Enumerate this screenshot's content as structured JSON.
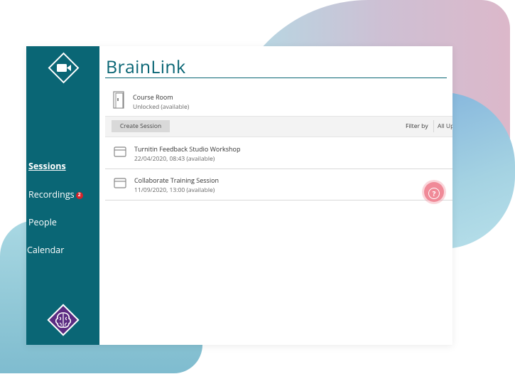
{
  "app": {
    "brand": "BrainLink"
  },
  "sidebar": {
    "items": [
      {
        "label": "Sessions",
        "active": true
      },
      {
        "label": "Recordings",
        "badge": "2"
      },
      {
        "label": "People"
      },
      {
        "label": "Calendar"
      }
    ],
    "top_logo_icon": "video-camera-icon",
    "bottom_logo_icon": "brain-icon"
  },
  "course_room": {
    "title": "Course Room",
    "status": "Unlocked (available)"
  },
  "toolbar": {
    "create_label": "Create Session",
    "filter_label": "Filter by",
    "filter_value": "All Upcoming"
  },
  "sessions": [
    {
      "title": "Turnitin Feedback Studio Workshop",
      "date": "22/04/2020, 08:43 (available)"
    },
    {
      "title": "Collaborate Training Session",
      "date": "11/09/2020, 13:00 (available)"
    }
  ],
  "help": {
    "glyph": "?"
  },
  "colors": {
    "teal": "#0a6675",
    "purple": "#5b2b82",
    "badge": "#d6232a",
    "help": "#f08a98"
  }
}
